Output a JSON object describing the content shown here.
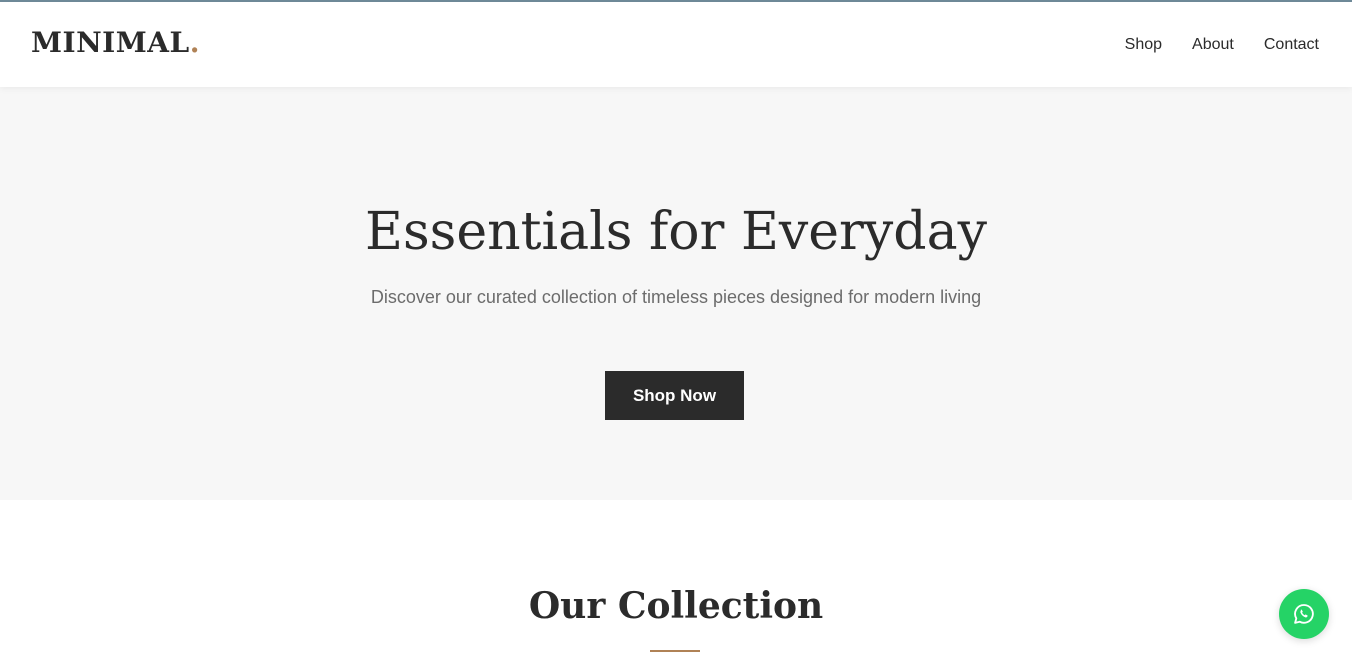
{
  "brand": {
    "name": "MINIMAL",
    "dot": ".",
    "accent_color": "#b08256"
  },
  "nav": {
    "items": [
      {
        "label": "Shop"
      },
      {
        "label": "About"
      },
      {
        "label": "Contact"
      }
    ]
  },
  "hero": {
    "title": "Essentials for Everyday",
    "subtitle": "Discover our curated collection of timeless pieces designed for modern living",
    "cta_label": "Shop Now",
    "background_color": "#f7f7f7",
    "button_color": "#2b2b2b"
  },
  "collection": {
    "title": "Our Collection"
  },
  "floating": {
    "icon": "whatsapp-icon",
    "color": "#25d366"
  }
}
